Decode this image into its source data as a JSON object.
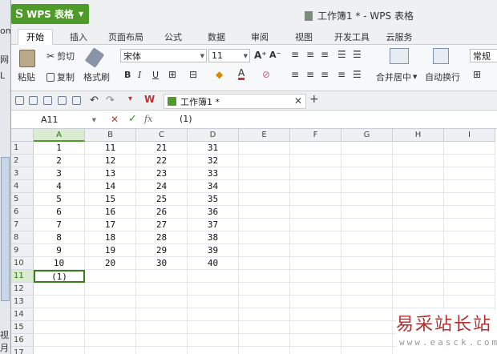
{
  "left_window": {
    "texts": [
      "om",
      "网",
      "L",
      "视月"
    ]
  },
  "titlebar": {
    "app_button": "WPS 表格",
    "title": "工作簿1 * - WPS 表格"
  },
  "tabs": [
    "开始",
    "插入",
    "页面布局",
    "公式",
    "数据",
    "审阅",
    "视图",
    "开发工具",
    "云服务"
  ],
  "active_tab": "开始",
  "ribbon": {
    "paste": "粘贴",
    "cut": "剪切",
    "copy": "复制",
    "format_painter": "格式刷",
    "font_name": "宋体",
    "font_size": "11",
    "grow_font": "A⁺",
    "shrink_font": "A⁻",
    "bold": "B",
    "italic": "I",
    "underline": "U",
    "font_color_glyph": "A",
    "merge_center": "合并居中",
    "wrap_text": "自动换行",
    "number_format": "常规"
  },
  "doc_tab": {
    "title": "工作簿1 *"
  },
  "formula_bar": {
    "cell_ref": "A11",
    "fx": "fx",
    "content": "(1)"
  },
  "grid": {
    "columns": [
      "A",
      "B",
      "C",
      "D",
      "E",
      "F",
      "G",
      "H",
      "I"
    ],
    "selected_column": "A",
    "selected_row": 11,
    "rows": [
      [
        "1",
        "11",
        "21",
        "31"
      ],
      [
        "2",
        "12",
        "22",
        "32"
      ],
      [
        "3",
        "13",
        "23",
        "33"
      ],
      [
        "4",
        "14",
        "24",
        "34"
      ],
      [
        "5",
        "15",
        "25",
        "35"
      ],
      [
        "6",
        "16",
        "26",
        "36"
      ],
      [
        "7",
        "17",
        "27",
        "37"
      ],
      [
        "8",
        "18",
        "28",
        "38"
      ],
      [
        "9",
        "19",
        "29",
        "39"
      ],
      [
        "10",
        "20",
        "30",
        "40"
      ],
      [
        "(1)",
        "",
        "",
        ""
      ],
      [
        "",
        "",
        "",
        ""
      ],
      [
        "",
        "",
        "",
        ""
      ],
      [
        "",
        "",
        "",
        ""
      ],
      [
        "",
        "",
        "",
        ""
      ],
      [
        "",
        "",
        "",
        ""
      ],
      [
        "",
        "",
        "",
        ""
      ]
    ]
  },
  "watermark": {
    "main": "易采站长站",
    "sub": "www.easck.com"
  },
  "colors": {
    "brand": "#4e9a2a",
    "watermark": "#b02f2f",
    "cancel": "#c0392b",
    "confirm": "#3a8a2a"
  }
}
